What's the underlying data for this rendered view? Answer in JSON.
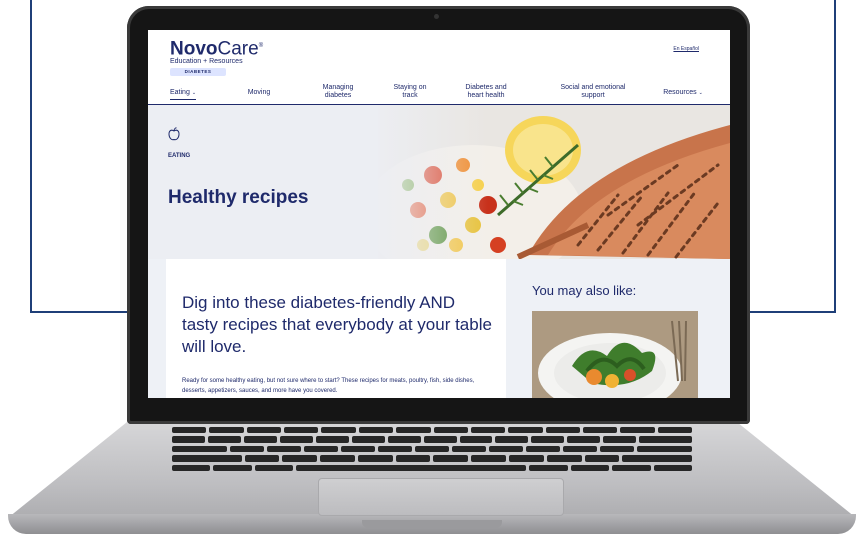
{
  "brand": {
    "name_bold": "Novo",
    "name_light": "Care",
    "registered": "®",
    "subtitle": "Education + Resources",
    "badge": "DIABETES"
  },
  "language_link": "En Español",
  "nav": {
    "items": [
      {
        "label": "Eating",
        "caret": "⌄"
      },
      {
        "label": "Moving"
      },
      {
        "label": "Managing diabetes"
      },
      {
        "label": "Staying on track"
      },
      {
        "label": "Diabetes and heart health"
      },
      {
        "label": "Social and emotional support"
      },
      {
        "label": "Resources",
        "caret": "⌄"
      }
    ]
  },
  "hero": {
    "icon": "apple-icon",
    "kicker": "EATING",
    "title": "Healthy recipes"
  },
  "main": {
    "headline": "Dig into these diabetes-friendly AND tasty recipes that everybody at your table will love.",
    "body": "Ready for some healthy eating, but not sure where to start? These recipes for meats, poultry, fish, side dishes, desserts, appetizers, sauces, and more have you covered."
  },
  "sidebar": {
    "title": "You may also like:"
  },
  "colors": {
    "brand_navy": "#1f2a6b",
    "badge_bg": "#dde4ff",
    "frame_blue": "#1f3f78"
  }
}
